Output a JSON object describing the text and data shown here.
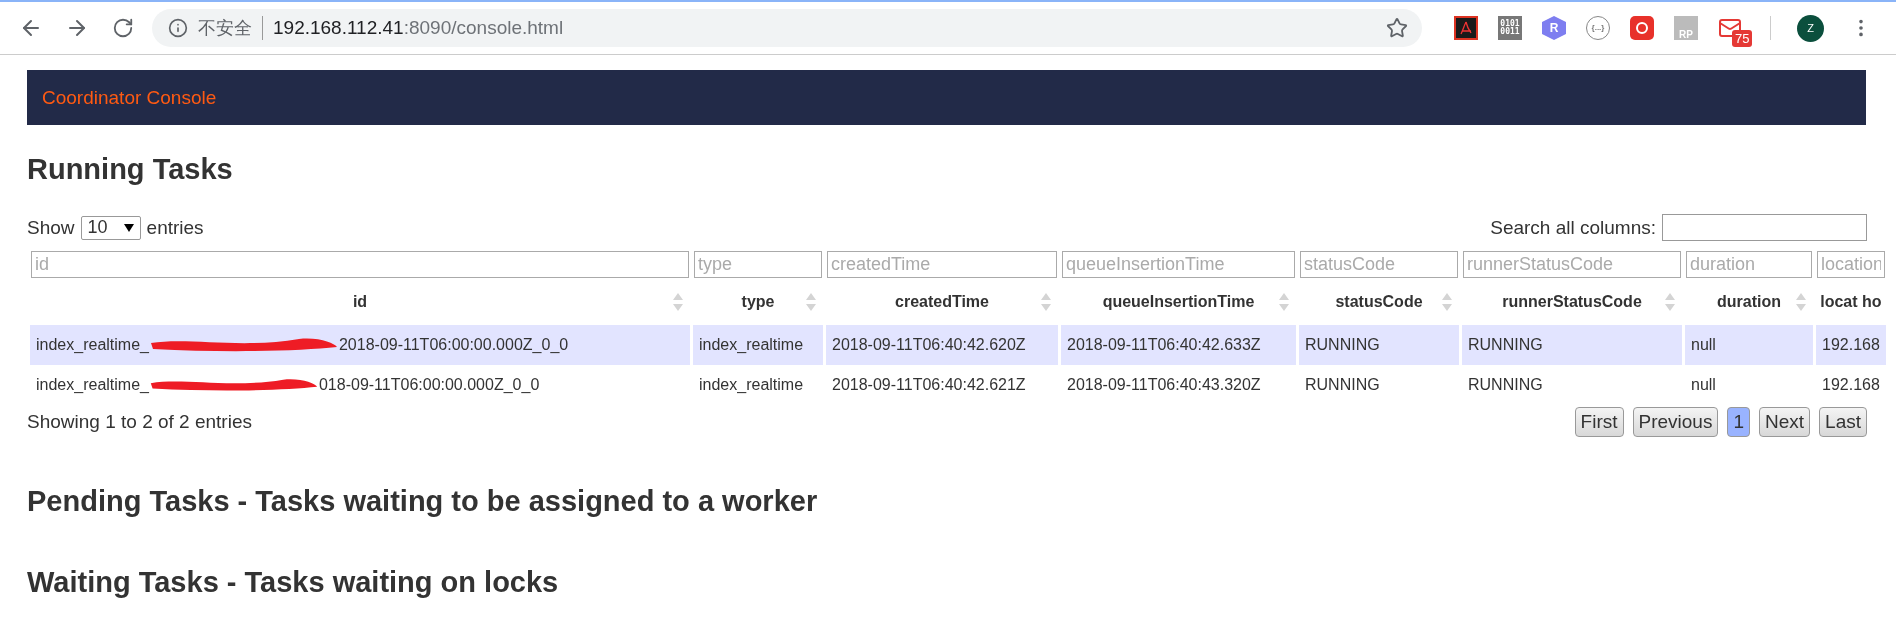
{
  "browser": {
    "security_label": "不安全",
    "url_host": "192.168.112.41",
    "url_rest": ":8090/console.html",
    "extensions": [
      {
        "kind": "pdf"
      },
      {
        "kind": "binary",
        "label": "0101\n0011"
      },
      {
        "kind": "hex",
        "label": "R"
      },
      {
        "kind": "braces",
        "label": "{...}"
      },
      {
        "kind": "red"
      },
      {
        "kind": "rp",
        "label": "RP"
      },
      {
        "kind": "mail",
        "badge": "75"
      }
    ],
    "avatar": "Z"
  },
  "header": {
    "title": "Coordinator Console"
  },
  "sections": [
    {
      "title": "Running Tasks",
      "table": {
        "length_label_before": "Show",
        "length_value": "10",
        "length_label_after": "entries",
        "search_label": "Search all columns:",
        "columns": [
          {
            "label": "id",
            "placeholder": "id",
            "sortable": true
          },
          {
            "label": "type",
            "placeholder": "type",
            "sortable": true
          },
          {
            "label": "createdTime",
            "placeholder": "createdTime",
            "sortable": true
          },
          {
            "label": "queueInsertionTime",
            "placeholder": "queueInsertionTime",
            "sortable": true
          },
          {
            "label": "statusCode",
            "placeholder": "statusCode",
            "sortable": true
          },
          {
            "label": "runnerStatusCode",
            "placeholder": "runnerStatusCode",
            "sortable": true
          },
          {
            "label": "duration",
            "placeholder": "duration",
            "sortable": true
          },
          {
            "label": "locat ho",
            "placeholder": "location",
            "sortable": false
          }
        ],
        "rows": [
          {
            "selected": true,
            "cells": [
              {
                "start": "index_realtime_",
                "end": "2018-09-11T06:00:00.000Z_0_0"
              },
              "index_realtime",
              "2018-09-11T06:40:42.620Z",
              "2018-09-11T06:40:42.633Z",
              "RUNNING",
              "RUNNING",
              "null",
              "192.168"
            ]
          },
          {
            "selected": false,
            "cells": [
              {
                "start": "index_realtime_",
                "end": "018-09-11T06:00:00.000Z_0_0"
              },
              "index_realtime",
              "2018-09-11T06:40:42.621Z",
              "2018-09-11T06:40:43.320Z",
              "RUNNING",
              "RUNNING",
              "null",
              "192.168"
            ]
          }
        ],
        "info": "Showing 1 to 2 of 2 entries",
        "pages": [
          {
            "label": "First",
            "selected": false
          },
          {
            "label": "Previous",
            "selected": false
          },
          {
            "label": "1",
            "selected": true
          },
          {
            "label": "Next",
            "selected": false
          },
          {
            "label": "Last",
            "selected": false
          }
        ]
      }
    },
    {
      "title": "Pending Tasks - Tasks waiting to be assigned to a worker"
    },
    {
      "title": "Waiting Tasks - Tasks waiting on locks"
    }
  ]
}
